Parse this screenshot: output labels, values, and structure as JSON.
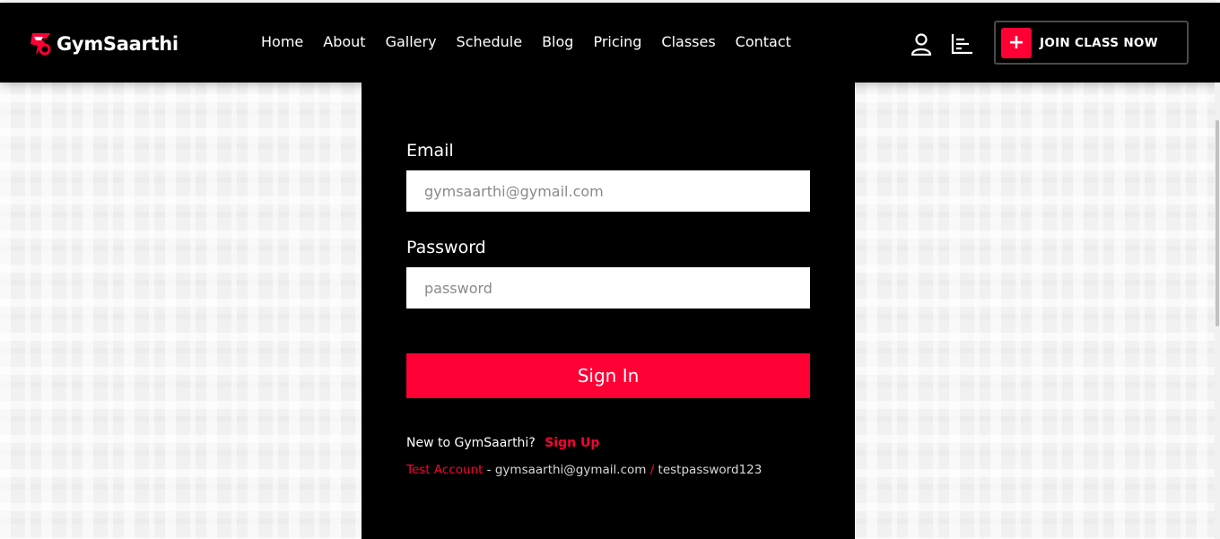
{
  "brand": {
    "name": "GymSaarthi",
    "accent": "#fe0034"
  },
  "nav": {
    "items": [
      {
        "label": "Home"
      },
      {
        "label": "About"
      },
      {
        "label": "Gallery"
      },
      {
        "label": "Schedule"
      },
      {
        "label": "Blog"
      },
      {
        "label": "Pricing"
      },
      {
        "label": "Classes"
      },
      {
        "label": "Contact"
      }
    ],
    "icons": [
      "user-icon",
      "bar-chart-icon"
    ],
    "cta": {
      "icon": "plus-icon",
      "label": "JOIN CLASS NOW"
    }
  },
  "form": {
    "email": {
      "label": "Email",
      "placeholder": "gymsaarthi@gymail.com"
    },
    "password": {
      "label": "Password",
      "placeholder": "password"
    },
    "submit_label": "Sign In",
    "signup_prompt": "New to GymSaarthi?",
    "signup_link": "Sign Up",
    "test_account": {
      "label": "Test Account",
      "dash": " - ",
      "email": "gymsaarthi@gymail.com",
      "slash": " / ",
      "password": "testpassword123"
    }
  }
}
